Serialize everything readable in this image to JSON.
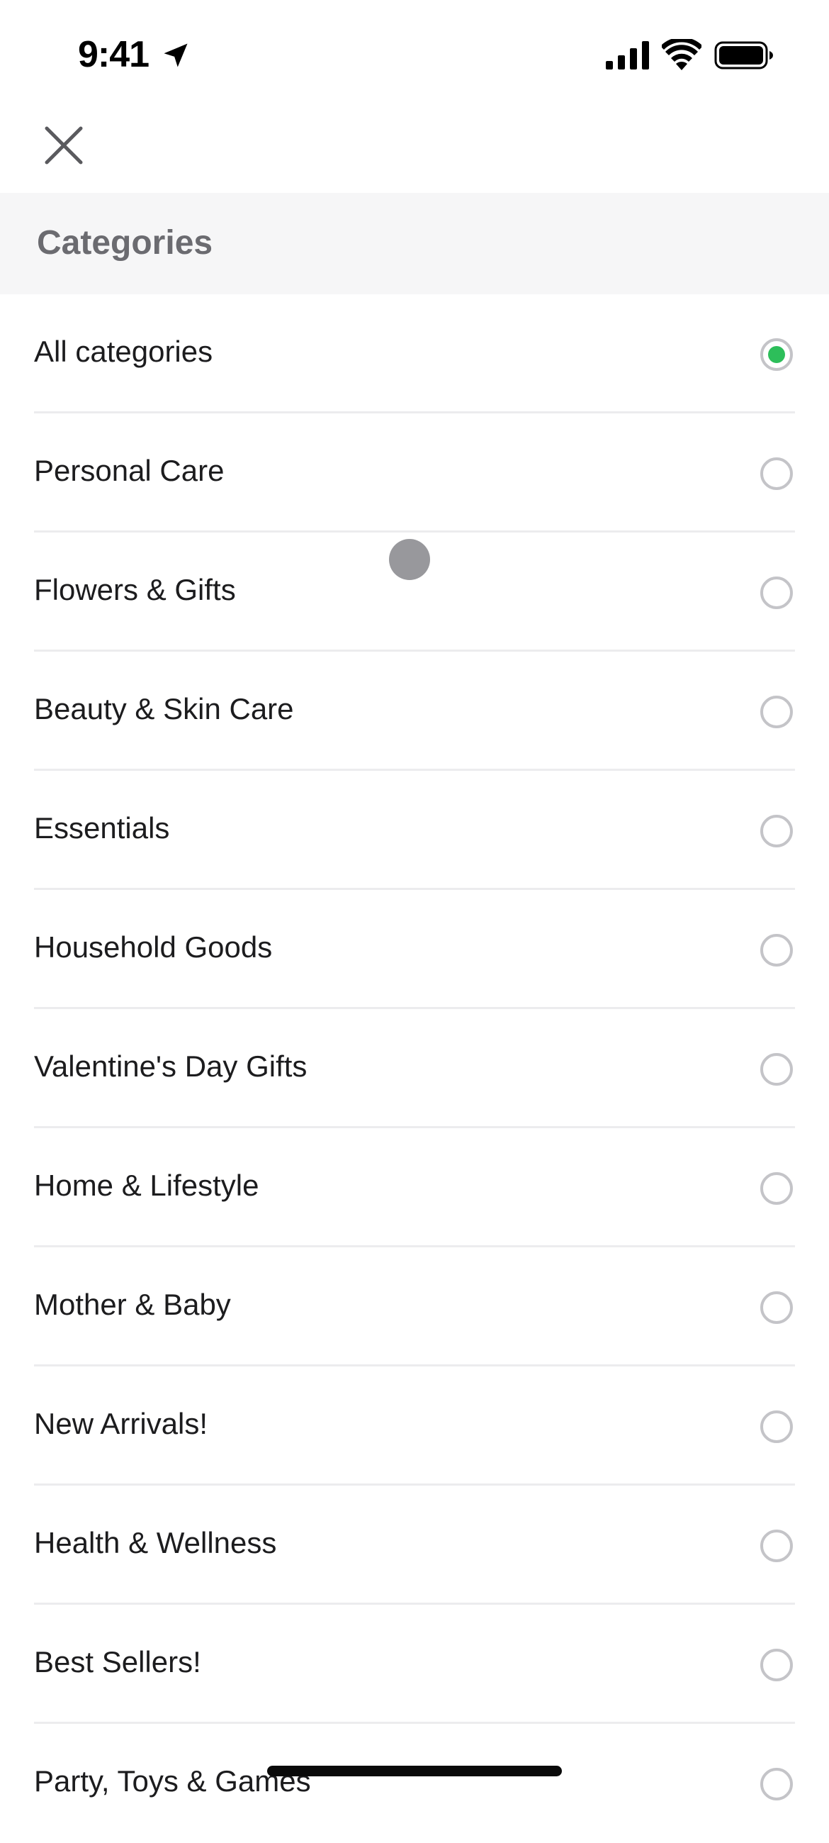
{
  "status_bar": {
    "time": "9:41"
  },
  "header": {
    "close_icon": "close-icon"
  },
  "section": {
    "title": "Categories"
  },
  "colors": {
    "accent_selected": "#2dbe5a",
    "section_bg": "#f6f6f7",
    "radio_border": "#c4c4c8"
  },
  "categories": [
    {
      "label": "All categories",
      "selected": true
    },
    {
      "label": "Personal Care",
      "selected": false
    },
    {
      "label": "Flowers & Gifts",
      "selected": false
    },
    {
      "label": "Beauty & Skin Care",
      "selected": false
    },
    {
      "label": "Essentials",
      "selected": false
    },
    {
      "label": "Household Goods",
      "selected": false
    },
    {
      "label": "Valentine's Day Gifts",
      "selected": false
    },
    {
      "label": "Home & Lifestyle",
      "selected": false
    },
    {
      "label": "Mother & Baby",
      "selected": false
    },
    {
      "label": "New Arrivals!",
      "selected": false
    },
    {
      "label": "Health & Wellness",
      "selected": false
    },
    {
      "label": "Best Sellers!",
      "selected": false
    },
    {
      "label": "Party, Toys & Games",
      "selected": false
    }
  ]
}
